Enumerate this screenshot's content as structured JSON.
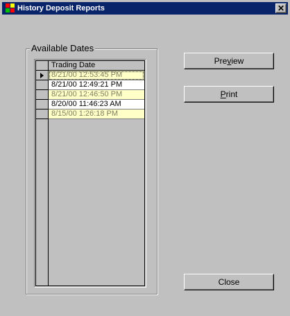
{
  "window": {
    "title": "History Deposit Reports",
    "close_glyph": "✕"
  },
  "group": {
    "label": "Available Dates"
  },
  "grid": {
    "column_header": "Trading Date",
    "rows": [
      {
        "value": "8/21/00 12:53:45 PM",
        "style": "yellow",
        "current": true
      },
      {
        "value": "8/21/00 12:49:21 PM",
        "style": "white",
        "current": false
      },
      {
        "value": "8/21/00 12:46:50 PM",
        "style": "yellow",
        "current": false
      },
      {
        "value": "8/20/00 11:46:23 AM",
        "style": "white",
        "current": false
      },
      {
        "value": "8/15/00 1:26:18 PM",
        "style": "yellow",
        "current": false
      }
    ]
  },
  "buttons": {
    "preview": {
      "pre": "Pre",
      "accel": "v",
      "post": "iew"
    },
    "print": {
      "pre": "",
      "accel": "P",
      "post": "rint"
    },
    "close": {
      "label": "Close"
    }
  },
  "colors": {
    "titlebar": "#0a246a",
    "face": "#c0c0c0",
    "row_highlight": "#ffffc8"
  }
}
